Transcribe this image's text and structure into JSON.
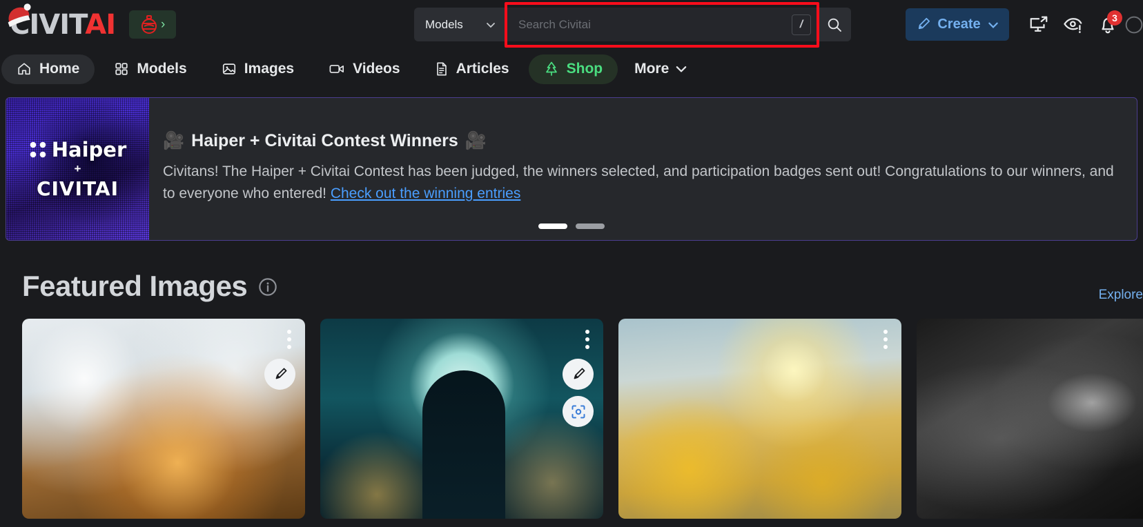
{
  "header": {
    "logo": {
      "civit": "CIVIT",
      "ai": "AI",
      "icon": "santa-hat-icon"
    },
    "xmas_button": {
      "name": "christmas-ornament-button",
      "chevron": "›"
    },
    "search": {
      "category_label": "Models",
      "placeholder": "Search Civitai",
      "value": "",
      "shortcut_key": "/",
      "highlight_color": "#fc0d1b"
    },
    "create_button": {
      "label": "Create",
      "icon": "paintbrush-icon",
      "chevron": "⌄"
    },
    "icons": [
      {
        "name": "screen-share-icon"
      },
      {
        "name": "eye-alert-icon"
      },
      {
        "name": "notification-bell-icon",
        "badge": "3"
      }
    ]
  },
  "nav": {
    "items": [
      {
        "label": "Home",
        "icon": "home-icon",
        "active": true
      },
      {
        "label": "Models",
        "icon": "grid-icon",
        "active": false
      },
      {
        "label": "Images",
        "icon": "image-icon",
        "active": false
      },
      {
        "label": "Videos",
        "icon": "video-icon",
        "active": false
      },
      {
        "label": "Articles",
        "icon": "document-icon",
        "active": false
      },
      {
        "label": "Shop",
        "icon": "christmas-tree-icon",
        "active": false,
        "highlight": "#4ade80"
      }
    ],
    "more_label": "More"
  },
  "banner": {
    "thumbnail": {
      "brand": "Haiper",
      "plus": "+",
      "partner": "CIVITAI"
    },
    "title": "Haiper + Civitai Contest Winners",
    "emoji_left": "🎥",
    "emoji_right": "🎥",
    "description": "Civitans! The Haiper + Civitai Contest has been judged, the winners selected, and participation badges sent out! Congratulations to our winners, and",
    "description_line2": "to everyone who entered! ",
    "link_text": "Check out the winning entries",
    "dots": [
      {
        "active": true
      },
      {
        "active": false
      }
    ]
  },
  "featured": {
    "title": "Featured Images",
    "info_icon": "info-circle-icon",
    "explore_link": "Explore",
    "cards": [
      {
        "name": "featured-image-card-1",
        "art": "art1",
        "menu_icon": "three-dots-icon",
        "buttons": [
          {
            "name": "remix-brush-button",
            "icon": "paintbrush-icon"
          }
        ]
      },
      {
        "name": "featured-image-card-2",
        "art": "art2",
        "menu_icon": "three-dots-icon",
        "buttons": [
          {
            "name": "remix-brush-button",
            "icon": "paintbrush-icon"
          },
          {
            "name": "image-scan-button",
            "icon": "scan-frame-icon"
          }
        ]
      },
      {
        "name": "featured-image-card-3",
        "art": "art3",
        "menu_icon": "three-dots-icon",
        "buttons": []
      },
      {
        "name": "featured-image-card-4",
        "art": "art4",
        "menu_icon": "three-dots-icon",
        "buttons": []
      }
    ]
  }
}
